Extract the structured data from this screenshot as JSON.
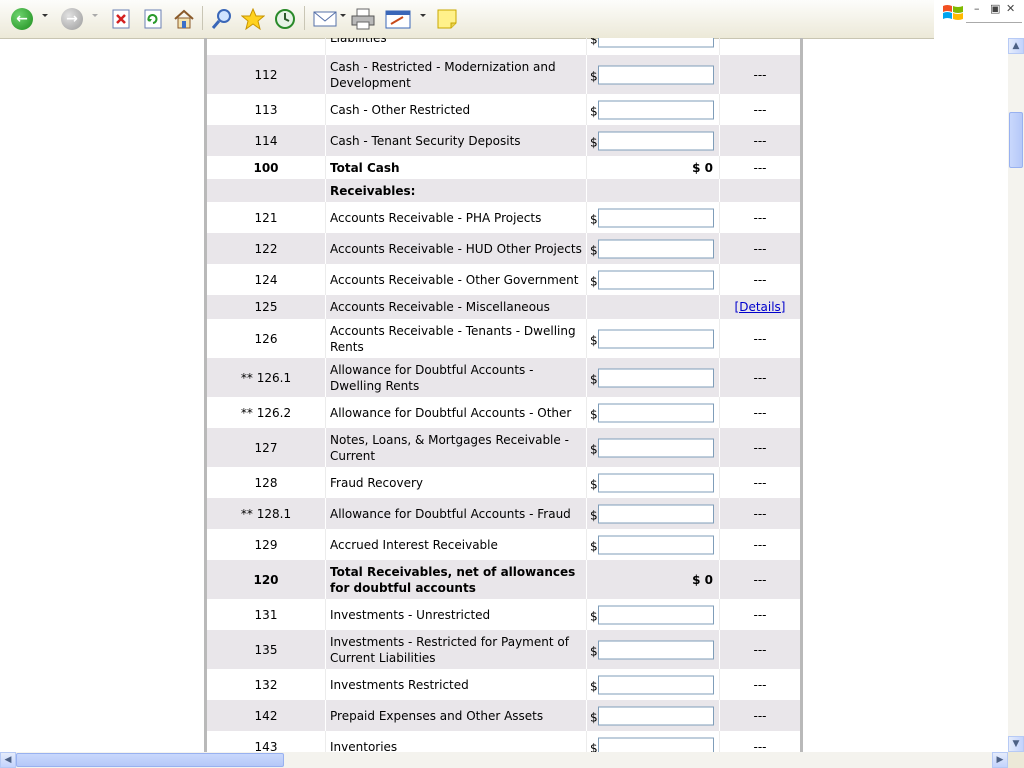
{
  "toolbar": {
    "icons": [
      "back-icon",
      "forward-icon",
      "stop-icon",
      "refresh-icon",
      "home-icon",
      "search-icon",
      "favorites-icon",
      "history-icon",
      "mail-icon",
      "print-icon",
      "edit-icon",
      "note-icon"
    ]
  },
  "colors": {
    "row_shaded": "#e9e6ea",
    "input_border": "#7f9db9",
    "link": "#0000cc",
    "page_border": "#b9b9b9"
  },
  "table": {
    "rows": [
      {
        "code": "",
        "desc": "Liabilities",
        "amount_type": "input",
        "value": "",
        "ext": "",
        "shaded": false,
        "bold": false
      },
      {
        "code": "112",
        "desc": "Cash - Restricted - Modernization and Development",
        "amount_type": "input",
        "value": "",
        "ext": "---",
        "shaded": true,
        "bold": false
      },
      {
        "code": "113",
        "desc": "Cash - Other Restricted",
        "amount_type": "input",
        "value": "",
        "ext": "---",
        "shaded": false,
        "bold": false
      },
      {
        "code": "114",
        "desc": "Cash - Tenant Security Deposits",
        "amount_type": "input",
        "value": "",
        "ext": "---",
        "shaded": true,
        "bold": false
      },
      {
        "code": "100",
        "desc": "Total Cash",
        "amount_type": "total",
        "value": "$ 0",
        "ext": "---",
        "shaded": false,
        "bold": true
      },
      {
        "code": "",
        "desc": "Receivables:",
        "amount_type": "none",
        "value": "",
        "ext": "",
        "shaded": true,
        "bold": true
      },
      {
        "code": "121",
        "desc": "Accounts Receivable - PHA Projects",
        "amount_type": "input",
        "value": "",
        "ext": "---",
        "shaded": false,
        "bold": false
      },
      {
        "code": "122",
        "desc": "Accounts Receivable - HUD Other Projects",
        "amount_type": "input",
        "value": "",
        "ext": "---",
        "shaded": true,
        "bold": false
      },
      {
        "code": "124",
        "desc": "Accounts Receivable - Other Government",
        "amount_type": "input",
        "value": "",
        "ext": "---",
        "shaded": false,
        "bold": false
      },
      {
        "code": "125",
        "desc": "Accounts Receivable - Miscellaneous",
        "amount_type": "none",
        "value": "",
        "ext": "[Details]",
        "shaded": true,
        "bold": false
      },
      {
        "code": "126",
        "desc": "Accounts Receivable - Tenants - Dwelling Rents",
        "amount_type": "input",
        "value": "",
        "ext": "---",
        "shaded": false,
        "bold": false
      },
      {
        "code": "** 126.1",
        "desc": "Allowance for Doubtful Accounts - Dwelling Rents",
        "amount_type": "input",
        "value": "",
        "ext": "---",
        "shaded": true,
        "bold": false
      },
      {
        "code": "** 126.2",
        "desc": "Allowance for Doubtful Accounts - Other",
        "amount_type": "input",
        "value": "",
        "ext": "---",
        "shaded": false,
        "bold": false
      },
      {
        "code": "127",
        "desc": "Notes, Loans, & Mortgages Receivable - Current",
        "amount_type": "input",
        "value": "",
        "ext": "---",
        "shaded": true,
        "bold": false
      },
      {
        "code": "128",
        "desc": "Fraud Recovery",
        "amount_type": "input",
        "value": "",
        "ext": "---",
        "shaded": false,
        "bold": false
      },
      {
        "code": "** 128.1",
        "desc": "Allowance for Doubtful Accounts - Fraud",
        "amount_type": "input",
        "value": "",
        "ext": "---",
        "shaded": true,
        "bold": false
      },
      {
        "code": "129",
        "desc": "Accrued Interest Receivable",
        "amount_type": "input",
        "value": "",
        "ext": "---",
        "shaded": false,
        "bold": false
      },
      {
        "code": "120",
        "desc": "Total Receivables, net of allowances for doubtful accounts",
        "amount_type": "total",
        "value": "$ 0",
        "ext": "---",
        "shaded": true,
        "bold": true
      },
      {
        "code": "131",
        "desc": "Investments - Unrestricted",
        "amount_type": "input",
        "value": "",
        "ext": "---",
        "shaded": false,
        "bold": false
      },
      {
        "code": "135",
        "desc": "Investments - Restricted for Payment of Current Liabilities",
        "amount_type": "input",
        "value": "",
        "ext": "---",
        "shaded": true,
        "bold": false
      },
      {
        "code": "132",
        "desc": "Investments Restricted",
        "amount_type": "input",
        "value": "",
        "ext": "---",
        "shaded": false,
        "bold": false
      },
      {
        "code": "142",
        "desc": "Prepaid Expenses and Other Assets",
        "amount_type": "input",
        "value": "",
        "ext": "---",
        "shaded": true,
        "bold": false
      },
      {
        "code": "143",
        "desc": "Inventories",
        "amount_type": "input",
        "value": "",
        "ext": "---",
        "shaded": false,
        "bold": false
      }
    ]
  }
}
